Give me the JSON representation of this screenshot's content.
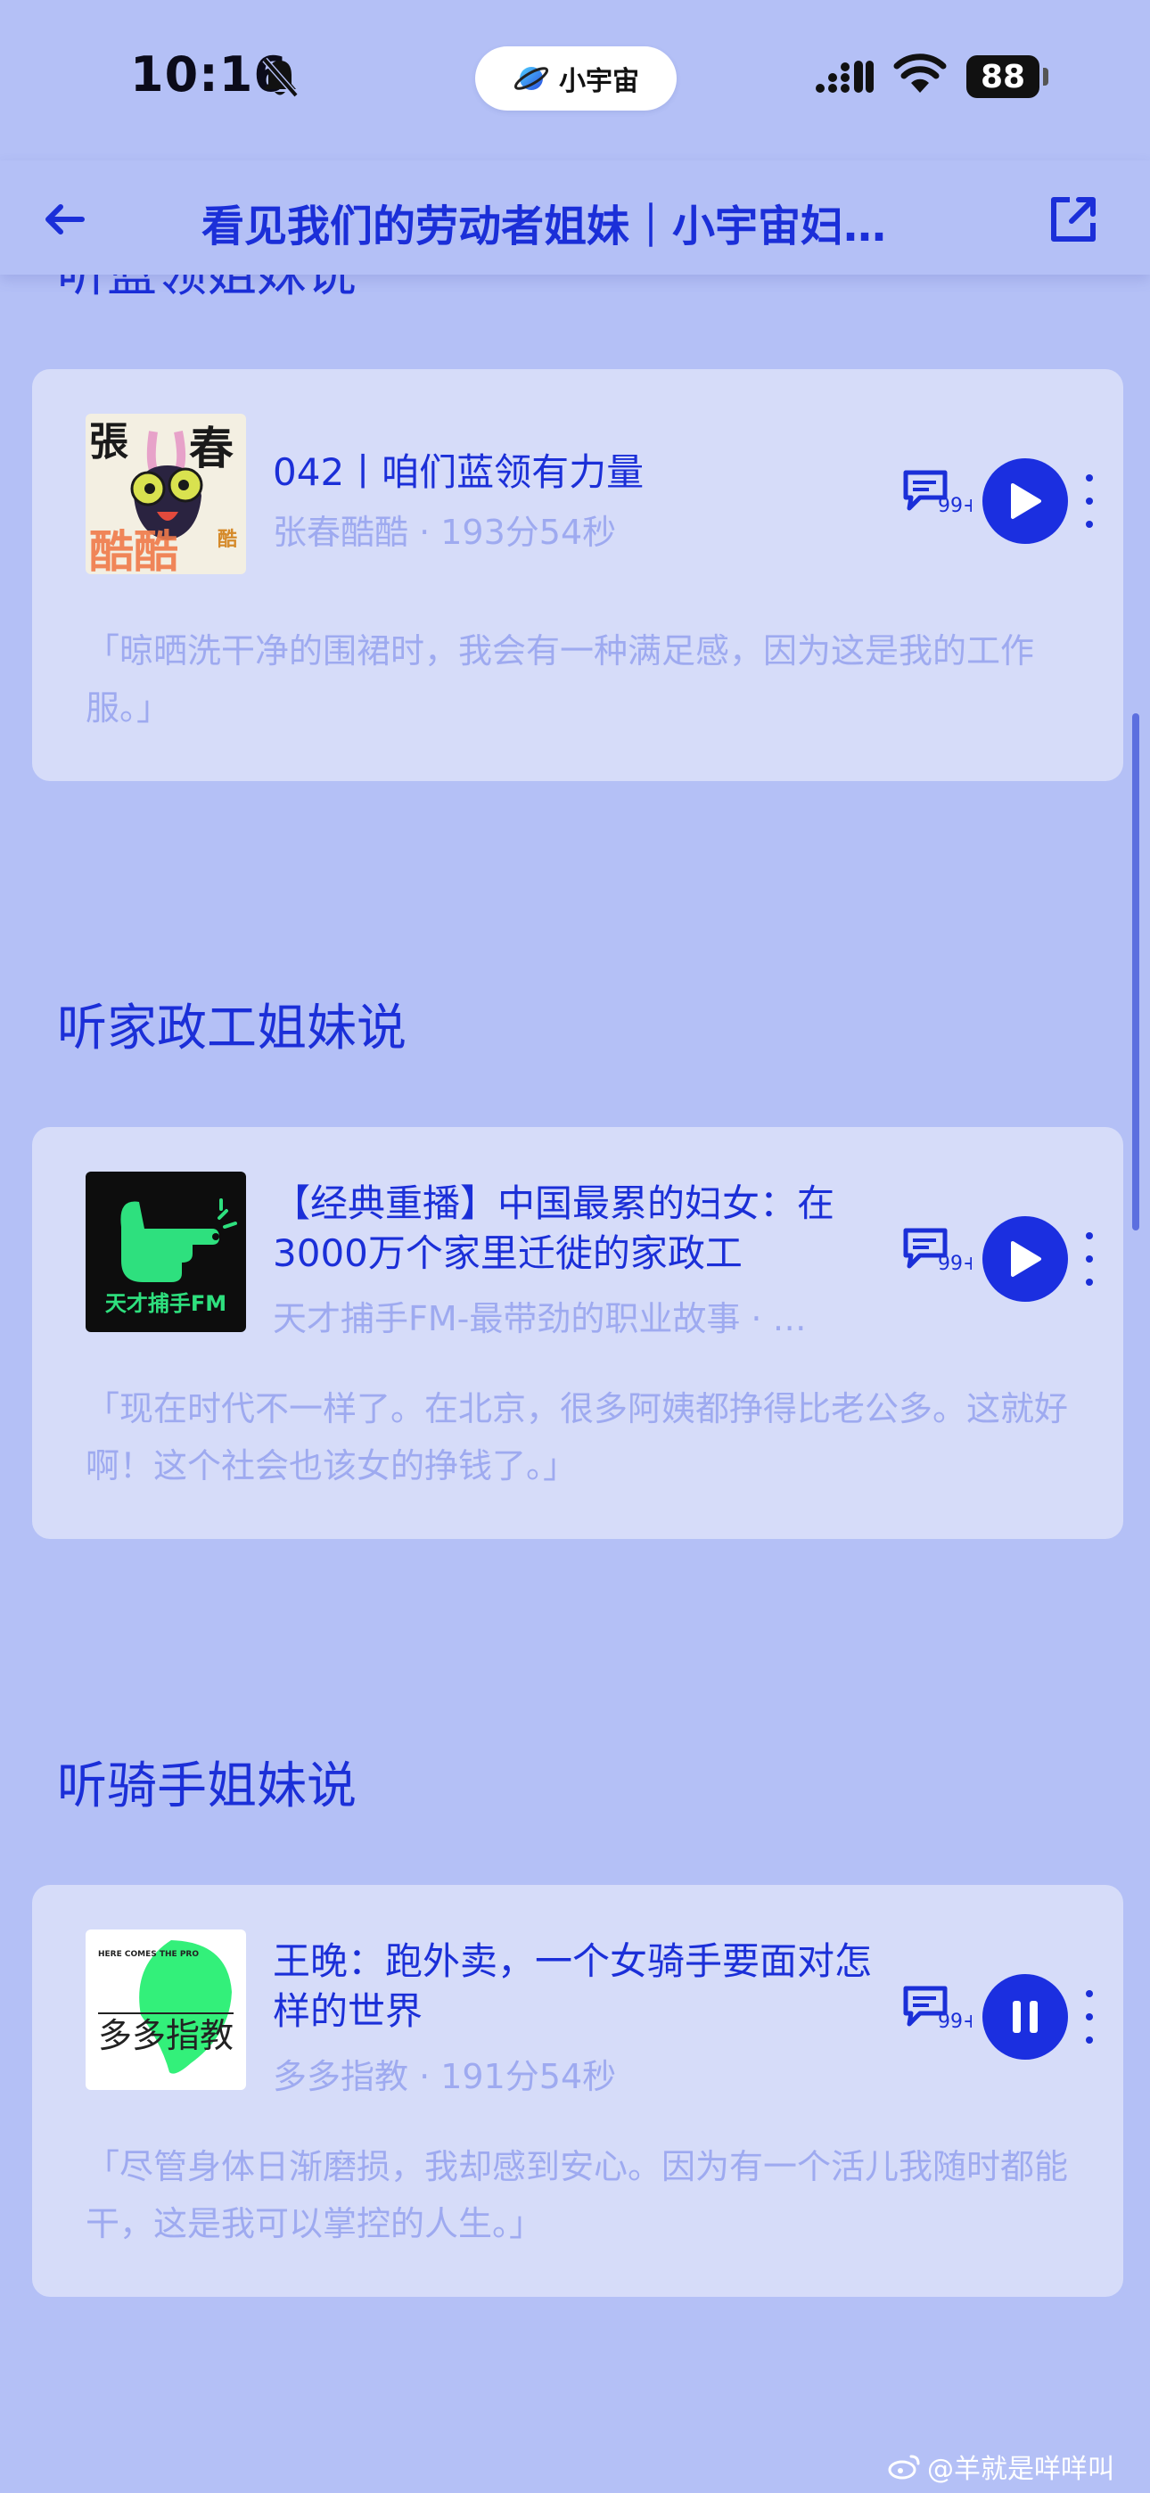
{
  "status_bar": {
    "time": "10:16",
    "pill_label": "小宇宙",
    "battery": "88"
  },
  "nav": {
    "title": "看见我们的劳动者姐妹｜小宇宙妇…"
  },
  "partial_heading": "听蓝领姐妹说",
  "sections": [
    {
      "heading": "听家政工姐妹说"
    },
    {
      "heading": "听骑手姐妹说"
    }
  ],
  "episodes": [
    {
      "cover_text_top_left": "張",
      "cover_text_top_right": "春",
      "cover_text_bottom": "酷酷",
      "cover_text_small": "酷",
      "title": "042丨咱们蓝领有力量",
      "meta": "张春酷酷 · 193分54秒",
      "comment_count": "99+",
      "state": "play",
      "quote": "「晾晒洗干净的围裙时，我会有一种满足感，因为这是我的工作服。」"
    },
    {
      "cover_text": "天才捕手FM",
      "title": "【经典重播】中国最累的妇女：在3000万个家里迁徙的家政工",
      "meta": "天才捕手FM-最带劲的职业故事 · …",
      "comment_count": "99+",
      "state": "play",
      "quote": "「现在时代不一样了。在北京，很多阿姨都挣得比老公多。这就好啊！这个社会也该女的挣钱了。」"
    },
    {
      "cover_text_small": "HERE COMES THE PRO",
      "cover_text": "多多指教",
      "title": "王晚：跑外卖，一个女骑手要面对怎样的世界",
      "meta": "多多指教 · 191分54秒",
      "comment_count": "99+",
      "state": "pause",
      "quote": "「尽管身体日渐磨损，我却感到安心。因为有一个活儿我随时都能干，这是我可以掌控的人生。」"
    }
  ],
  "watermark": "@羊就是咩咩叫",
  "colors": {
    "background": "#b4c0f6",
    "card": "#d6dcf9",
    "accent": "#1b2fd8",
    "muted_text": "#9eaaf0"
  }
}
